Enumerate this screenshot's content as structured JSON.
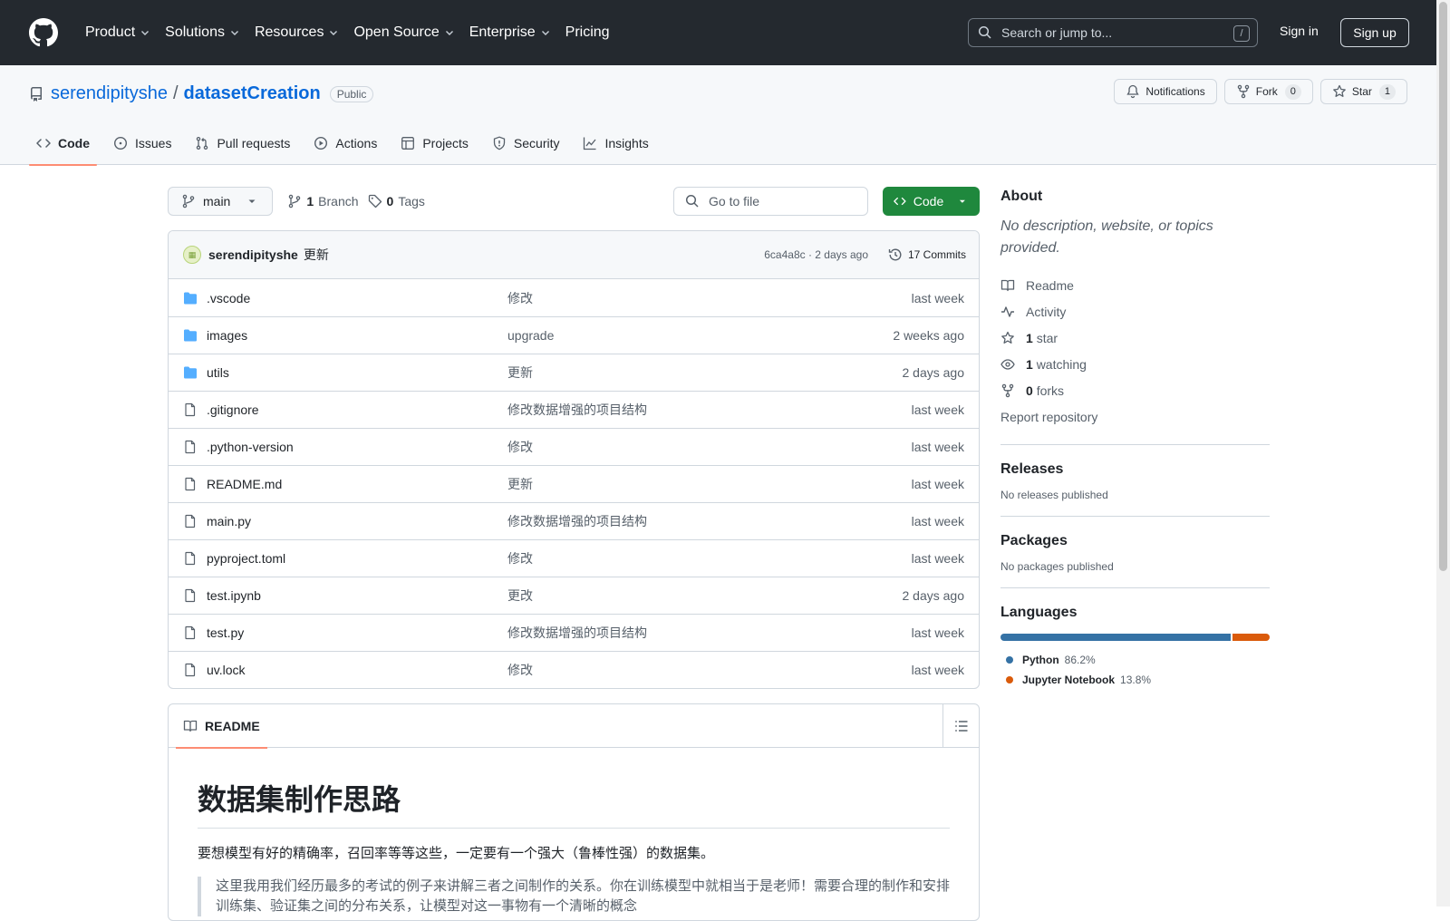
{
  "header": {
    "nav": [
      "Product",
      "Solutions",
      "Resources",
      "Open Source",
      "Enterprise",
      "Pricing"
    ],
    "search_placeholder": "Search or jump to...",
    "search_shortcut": "/",
    "sign_in": "Sign in",
    "sign_up": "Sign up"
  },
  "repo": {
    "owner": "serendipityshe",
    "separator": "/",
    "name": "datasetCreation",
    "visibility": "Public",
    "notifications_label": "Notifications",
    "fork_label": "Fork",
    "fork_count": "0",
    "star_label": "Star",
    "star_count": "1",
    "tabs": [
      "Code",
      "Issues",
      "Pull requests",
      "Actions",
      "Projects",
      "Security",
      "Insights"
    ]
  },
  "toolbar": {
    "branch": "main",
    "branch_count": "1",
    "branch_label": "Branch",
    "tag_count": "0",
    "tag_label": "Tags",
    "goto_placeholder": "Go to file",
    "code_button": "Code"
  },
  "commit": {
    "author": "serendipityshe",
    "message": "更新",
    "meta": "6ca4a8c · 2 days ago",
    "commits": "17 Commits"
  },
  "files": [
    {
      "name": ".vscode",
      "type": "dir",
      "message": "修改",
      "time": "last week"
    },
    {
      "name": "images",
      "type": "dir",
      "message": "upgrade",
      "time": "2 weeks ago"
    },
    {
      "name": "utils",
      "type": "dir",
      "message": "更新",
      "time": "2 days ago"
    },
    {
      "name": ".gitignore",
      "type": "file",
      "message": "修改数据增强的项目结构",
      "time": "last week"
    },
    {
      "name": ".python-version",
      "type": "file",
      "message": "修改",
      "time": "last week"
    },
    {
      "name": "README.md",
      "type": "file",
      "message": "更新",
      "time": "last week"
    },
    {
      "name": "main.py",
      "type": "file",
      "message": "修改数据增强的项目结构",
      "time": "last week"
    },
    {
      "name": "pyproject.toml",
      "type": "file",
      "message": "修改",
      "time": "last week"
    },
    {
      "name": "test.ipynb",
      "type": "file",
      "message": "更改",
      "time": "2 days ago"
    },
    {
      "name": "test.py",
      "type": "file",
      "message": "修改数据增强的项目结构",
      "time": "last week"
    },
    {
      "name": "uv.lock",
      "type": "file",
      "message": "修改",
      "time": "last week"
    }
  ],
  "readme": {
    "tab": "README",
    "h1": "数据集制作思路",
    "p1": "要想模型有好的精确率，召回率等等这些，一定要有一个强大（鲁棒性强）的数据集。",
    "quote": "这里我用我们经历最多的考试的例子来讲解三者之间制作的关系。你在训练模型中就相当于是老师！需要合理的制作和安排训练集、验证集之间的分布关系，让模型对这一事物有一个清晰的概念"
  },
  "about": {
    "title": "About",
    "description": "No description, website, or topics provided.",
    "links": {
      "readme": "Readme",
      "activity": "Activity",
      "stars_count": "1",
      "stars_label": "star",
      "watching_count": "1",
      "watching_label": "watching",
      "forks_count": "0",
      "forks_label": "forks",
      "report": "Report repository"
    }
  },
  "releases": {
    "title": "Releases",
    "text": "No releases published"
  },
  "packages": {
    "title": "Packages",
    "text": "No packages published"
  },
  "languages": {
    "title": "Languages",
    "items": [
      {
        "name": "Python",
        "percent": "86.2%",
        "value": 86.2,
        "color": "#3572A5"
      },
      {
        "name": "Jupyter Notebook",
        "percent": "13.8%",
        "value": 13.8,
        "color": "#DA5B0B"
      }
    ]
  }
}
